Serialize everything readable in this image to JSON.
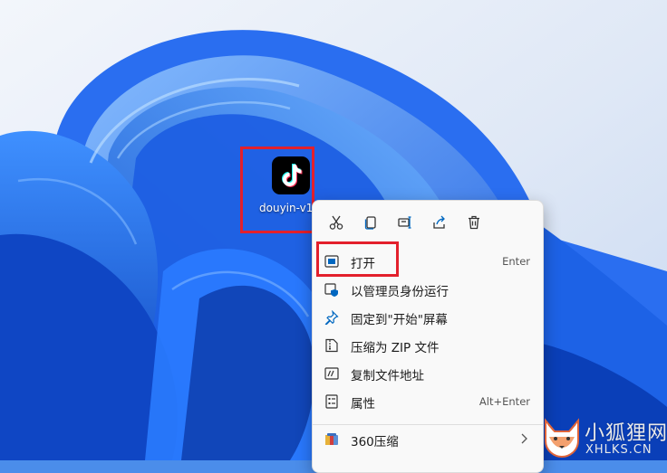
{
  "desktop": {
    "icon_label": "douyin-v1",
    "icon_name": "tiktok-app-icon"
  },
  "toolbar": {
    "buttons": [
      {
        "name": "cut-icon"
      },
      {
        "name": "copy-icon"
      },
      {
        "name": "rename-icon"
      },
      {
        "name": "share-icon"
      },
      {
        "name": "delete-icon"
      }
    ]
  },
  "menu": {
    "items": [
      {
        "label": "打开",
        "shortcut": "Enter",
        "icon": "open-icon"
      },
      {
        "label": "以管理员身份运行",
        "shortcut": "",
        "icon": "admin-shield-icon"
      },
      {
        "label": "固定到\"开始\"屏幕",
        "shortcut": "",
        "icon": "pin-icon"
      },
      {
        "label": "压缩为 ZIP 文件",
        "shortcut": "",
        "icon": "zip-icon"
      },
      {
        "label": "复制文件地址",
        "shortcut": "",
        "icon": "copy-path-icon"
      },
      {
        "label": "属性",
        "shortcut": "Alt+Enter",
        "icon": "properties-icon"
      },
      {
        "label": "360压缩",
        "shortcut": "",
        "icon": "zip-360-icon"
      }
    ]
  },
  "watermark": {
    "cn": "小狐狸网",
    "en": "XHLKS.CN"
  },
  "colors": {
    "highlight": "#e3202c",
    "menu_bg": "#f9f9f9",
    "accent": "#0067c0"
  }
}
